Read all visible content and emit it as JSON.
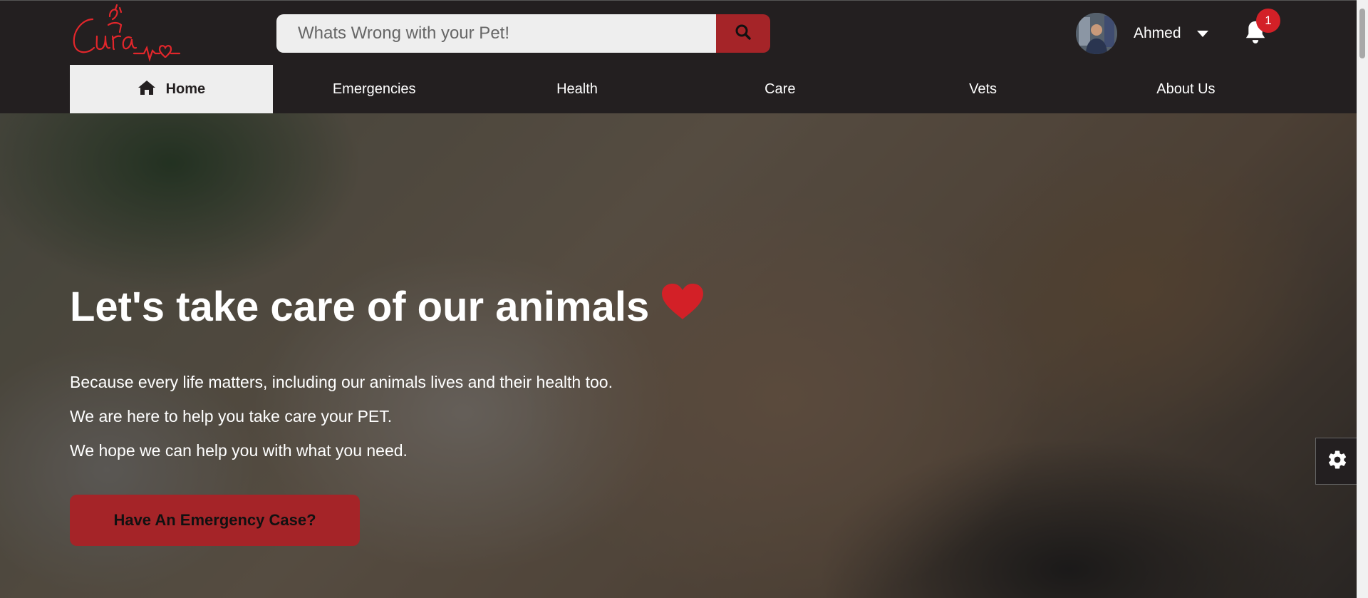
{
  "header": {
    "logo_text": "Cura",
    "search": {
      "placeholder": "Whats Wrong with your Pet!",
      "value": ""
    },
    "user": {
      "name": "Ahmed"
    },
    "notifications": {
      "count": "1"
    }
  },
  "nav": {
    "items": [
      {
        "label": "Home",
        "icon": "home-icon",
        "active": true
      },
      {
        "label": "Emergencies"
      },
      {
        "label": "Health"
      },
      {
        "label": "Care"
      },
      {
        "label": "Vets"
      },
      {
        "label": "About Us"
      }
    ]
  },
  "hero": {
    "title": "Let's take care of our animals",
    "lines": [
      "Because every life matters, including our animals lives and their health too.",
      "We are here to help you take care your PET.",
      "We hope we can help you with what you need."
    ],
    "cta_label": "Have An Emergency Case?"
  },
  "colors": {
    "accent": "#a52428",
    "header_bg": "#231f20",
    "badge": "#d32027",
    "heart": "#d32027"
  },
  "icons": [
    "search-icon",
    "home-icon",
    "bell-icon",
    "heart-icon",
    "gear-icon",
    "chevron-down-icon"
  ]
}
